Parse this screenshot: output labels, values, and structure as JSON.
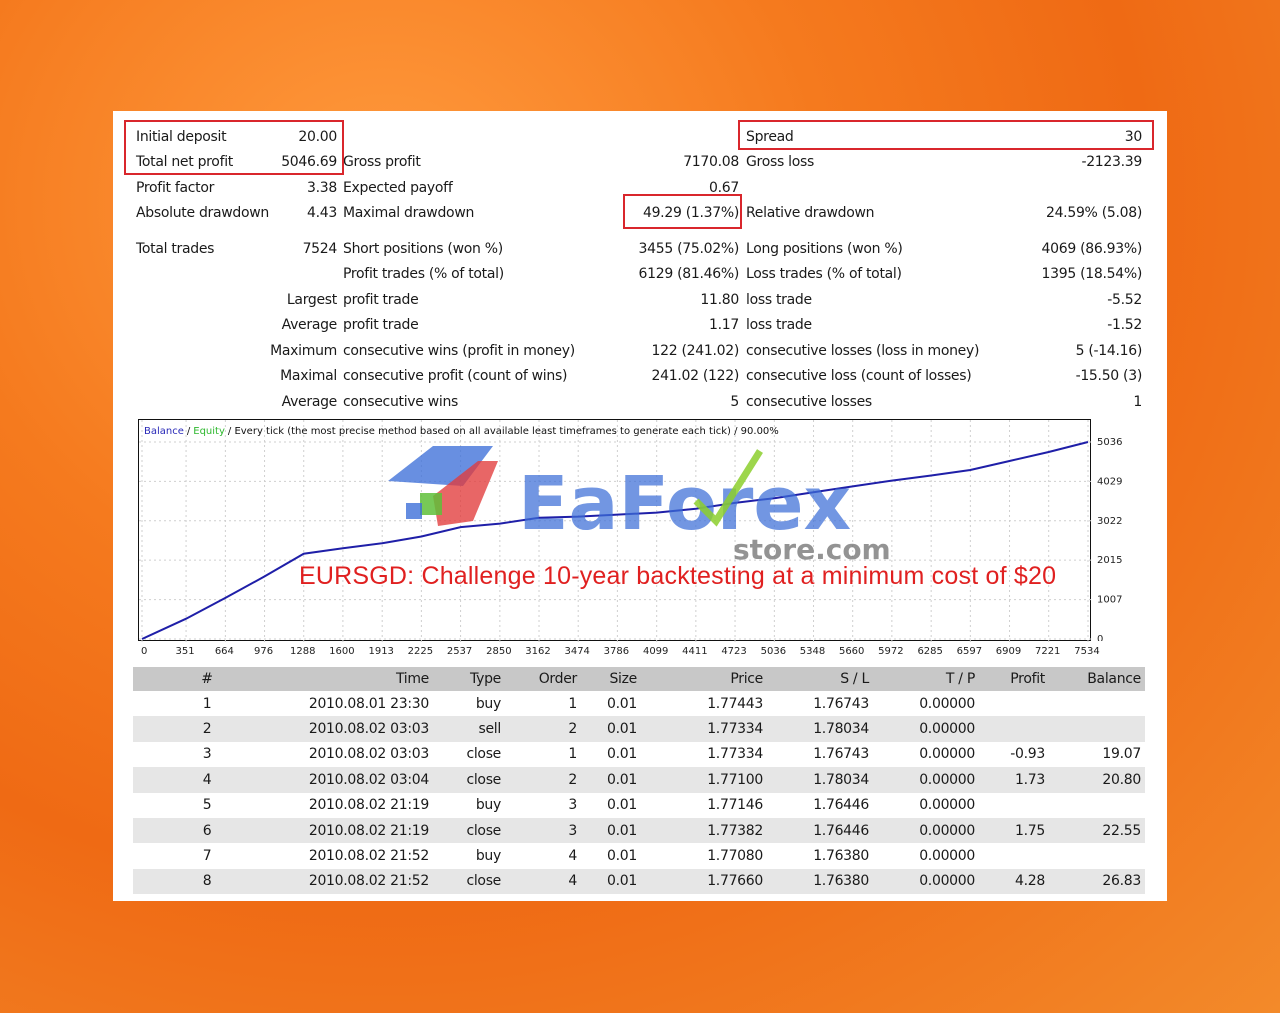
{
  "summary": {
    "initial_deposit_label": "Initial deposit",
    "initial_deposit": "20.00",
    "total_net_profit_label": "Total net profit",
    "total_net_profit": "5046.69",
    "gross_profit_label": "Gross profit",
    "gross_profit": "7170.08",
    "gross_loss_label": "Gross loss",
    "gross_loss": "-2123.39",
    "spread_label": "Spread",
    "spread": "30",
    "profit_factor_label": "Profit factor",
    "profit_factor": "3.38",
    "expected_payoff_label": "Expected payoff",
    "expected_payoff": "0.67",
    "absolute_drawdown_label": "Absolute drawdown",
    "absolute_drawdown": "4.43",
    "maximal_drawdown_label": "Maximal drawdown",
    "maximal_drawdown": "49.29 (1.37%)",
    "relative_drawdown_label": "Relative drawdown",
    "relative_drawdown": "24.59% (5.08)",
    "total_trades_label": "Total trades",
    "total_trades": "7524",
    "short_positions_label": "Short positions (won %)",
    "short_positions": "3455 (75.02%)",
    "long_positions_label": "Long positions (won %)",
    "long_positions": "4069 (86.93%)",
    "profit_trades_label": "Profit trades (% of total)",
    "profit_trades": "6129 (81.46%)",
    "loss_trades_label": "Loss trades (% of total)",
    "loss_trades": "1395 (18.54%)",
    "largest_label": "Largest",
    "largest_profit_label": "profit trade",
    "largest_profit": "11.80",
    "largest_loss_label": "loss trade",
    "largest_loss": "-5.52",
    "average_label": "Average",
    "average_profit_label": "profit trade",
    "average_profit": "1.17",
    "average_loss_label": "loss trade",
    "average_loss": "-1.52",
    "maximum_label": "Maximum",
    "max_consec_wins_label": "consecutive wins (profit in money)",
    "max_consec_wins": "122 (241.02)",
    "max_consec_losses_label": "consecutive losses (loss in money)",
    "max_consec_losses": "5 (-14.16)",
    "maximal_label": "Maximal",
    "maximal_consec_profit_label": "consecutive profit (count of wins)",
    "maximal_consec_profit": "241.02 (122)",
    "maximal_consec_loss_label": "consecutive loss (count of losses)",
    "maximal_consec_loss": "-15.50 (3)",
    "avg_label": "Average",
    "avg_consec_wins_label": "consecutive wins",
    "avg_consec_wins": "5",
    "avg_consec_losses_label": "consecutive losses",
    "avg_consec_losses": "1"
  },
  "chart_data": {
    "type": "line",
    "legend_balance": "Balance",
    "legend_sep": "/",
    "legend_equity": "Equity",
    "legend_rest": "/ Every tick (the most precise method based on all available least timeframes to generate each tick) / 90.00%",
    "x_ticks": [
      "0",
      "351",
      "664",
      "976",
      "1288",
      "1600",
      "1913",
      "2225",
      "2537",
      "2850",
      "3162",
      "3474",
      "3786",
      "4099",
      "4411",
      "4723",
      "5036",
      "5348",
      "5660",
      "5972",
      "6285",
      "6597",
      "6909",
      "7221",
      "7534"
    ],
    "y_ticks": [
      "5036",
      "4029",
      "3022",
      "2015",
      "1007",
      "0"
    ],
    "xlim": [
      0,
      7534
    ],
    "ylim": [
      0,
      5036
    ],
    "series": [
      {
        "color": "#1f1fa8",
        "x": [
          0,
          351,
          664,
          976,
          1288,
          1600,
          1913,
          2225,
          2537,
          2850,
          3162,
          3474,
          3786,
          4099,
          4411,
          4723,
          5036,
          5348,
          5660,
          5972,
          6285,
          6597,
          6909,
          7221,
          7534
        ],
        "y": [
          0,
          520,
          1050,
          1600,
          2180,
          2320,
          2450,
          2620,
          2860,
          2950,
          3100,
          3130,
          3180,
          3230,
          3330,
          3480,
          3600,
          3750,
          3900,
          4050,
          4180,
          4320,
          4550,
          4780,
          5036
        ]
      }
    ]
  },
  "watermark": {
    "brand": "EaForex",
    "sub": "store.com"
  },
  "caption": "EURSGD: Challenge 10-year backtesting at a minimum cost of $20",
  "table": {
    "headers": [
      "#",
      "Time",
      "Type",
      "Order",
      "Size",
      "Price",
      "S / L",
      "T / P",
      "Profit",
      "Balance"
    ],
    "rows": [
      [
        "1",
        "2010.08.01 23:30",
        "buy",
        "1",
        "0.01",
        "1.77443",
        "1.76743",
        "0.00000",
        "",
        ""
      ],
      [
        "2",
        "2010.08.02 03:03",
        "sell",
        "2",
        "0.01",
        "1.77334",
        "1.78034",
        "0.00000",
        "",
        ""
      ],
      [
        "3",
        "2010.08.02 03:03",
        "close",
        "1",
        "0.01",
        "1.77334",
        "1.76743",
        "0.00000",
        "-0.93",
        "19.07"
      ],
      [
        "4",
        "2010.08.02 03:04",
        "close",
        "2",
        "0.01",
        "1.77100",
        "1.78034",
        "0.00000",
        "1.73",
        "20.80"
      ],
      [
        "5",
        "2010.08.02 21:19",
        "buy",
        "3",
        "0.01",
        "1.77146",
        "1.76446",
        "0.00000",
        "",
        ""
      ],
      [
        "6",
        "2010.08.02 21:19",
        "close",
        "3",
        "0.01",
        "1.77382",
        "1.76446",
        "0.00000",
        "1.75",
        "22.55"
      ],
      [
        "7",
        "2010.08.02 21:52",
        "buy",
        "4",
        "0.01",
        "1.77080",
        "1.76380",
        "0.00000",
        "",
        ""
      ],
      [
        "8",
        "2010.08.02 21:52",
        "close",
        "4",
        "0.01",
        "1.77660",
        "1.76380",
        "0.00000",
        "4.28",
        "26.83"
      ]
    ]
  },
  "colors": {
    "highlight_box": "#d9262c",
    "balance_line": "#1f1fa8",
    "equity_label": "#2eb82e",
    "caption": "#e02020"
  }
}
